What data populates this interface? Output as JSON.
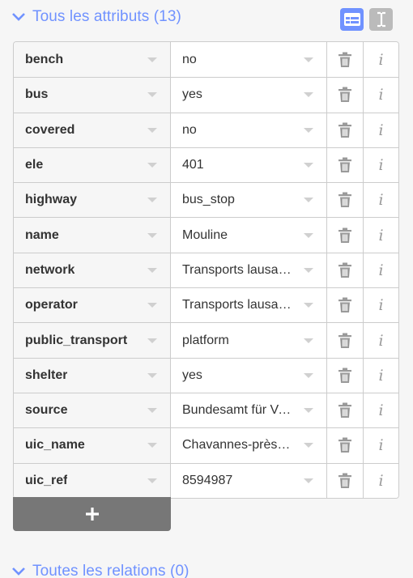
{
  "attributes_section": {
    "title": "Tous les attributs (13)",
    "view_list_icon": "list-view-icon",
    "view_text_icon": "text-view-icon"
  },
  "tags": [
    {
      "key": "bench",
      "value": "no"
    },
    {
      "key": "bus",
      "value": "yes"
    },
    {
      "key": "covered",
      "value": "no"
    },
    {
      "key": "ele",
      "value": "401"
    },
    {
      "key": "highway",
      "value": "bus_stop"
    },
    {
      "key": "name",
      "value": "Mouline"
    },
    {
      "key": "network",
      "value": "Transports lausan…"
    },
    {
      "key": "operator",
      "value": "Transports lausan…"
    },
    {
      "key": "public_transport",
      "value": "platform"
    },
    {
      "key": "shelter",
      "value": "yes"
    },
    {
      "key": "source",
      "value": "Bundesamt für Ve…"
    },
    {
      "key": "uic_name",
      "value": "Chavannes-près-R…"
    },
    {
      "key": "uic_ref",
      "value": "8594987"
    }
  ],
  "add_button": {
    "icon": "plus-icon"
  },
  "relations_section": {
    "title": "Toutes les relations (0)"
  },
  "colors": {
    "accent": "#7092ff",
    "icon_gray": "#9a9a9a",
    "add_bg": "#777777"
  }
}
